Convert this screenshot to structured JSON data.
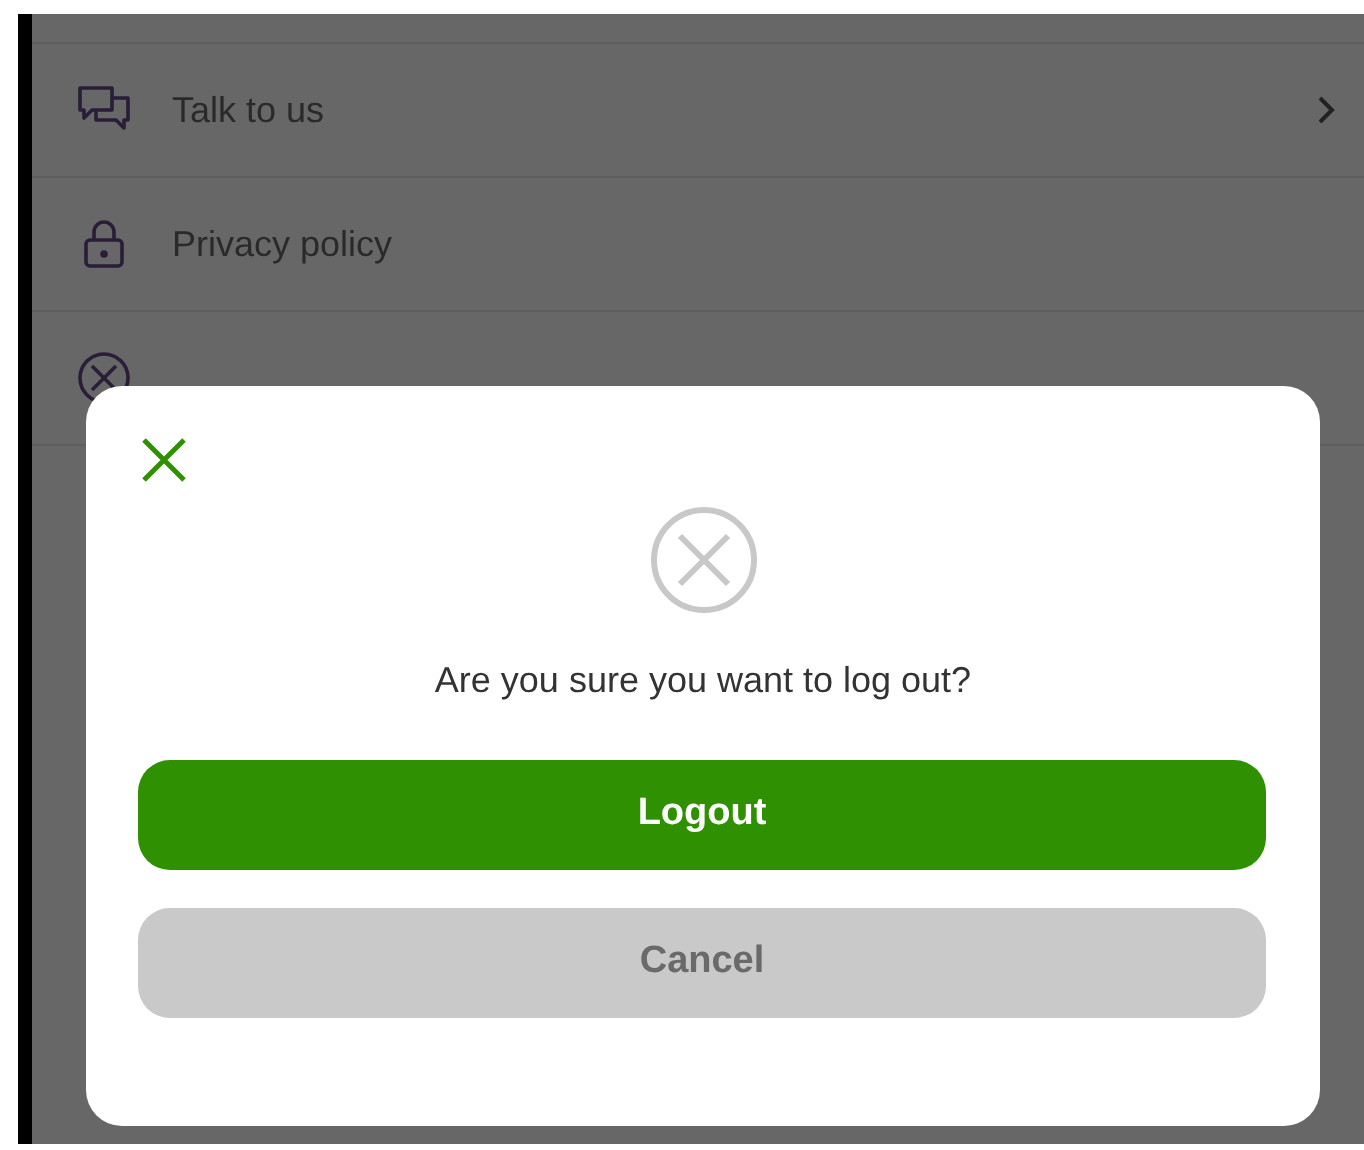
{
  "menu": {
    "items": [
      {
        "label": "Talk to us",
        "kind": "chat",
        "has_arrow": true
      },
      {
        "label": "Privacy policy",
        "kind": "lock",
        "has_arrow": false
      },
      {
        "kind": "logout",
        "has_arrow": false
      }
    ]
  },
  "dialog": {
    "message": "Are you sure you want to log out?",
    "buttons": [
      {
        "label": "Logout",
        "kind": "primary"
      },
      {
        "label": "Cancel",
        "kind": "secondary"
      }
    ]
  }
}
